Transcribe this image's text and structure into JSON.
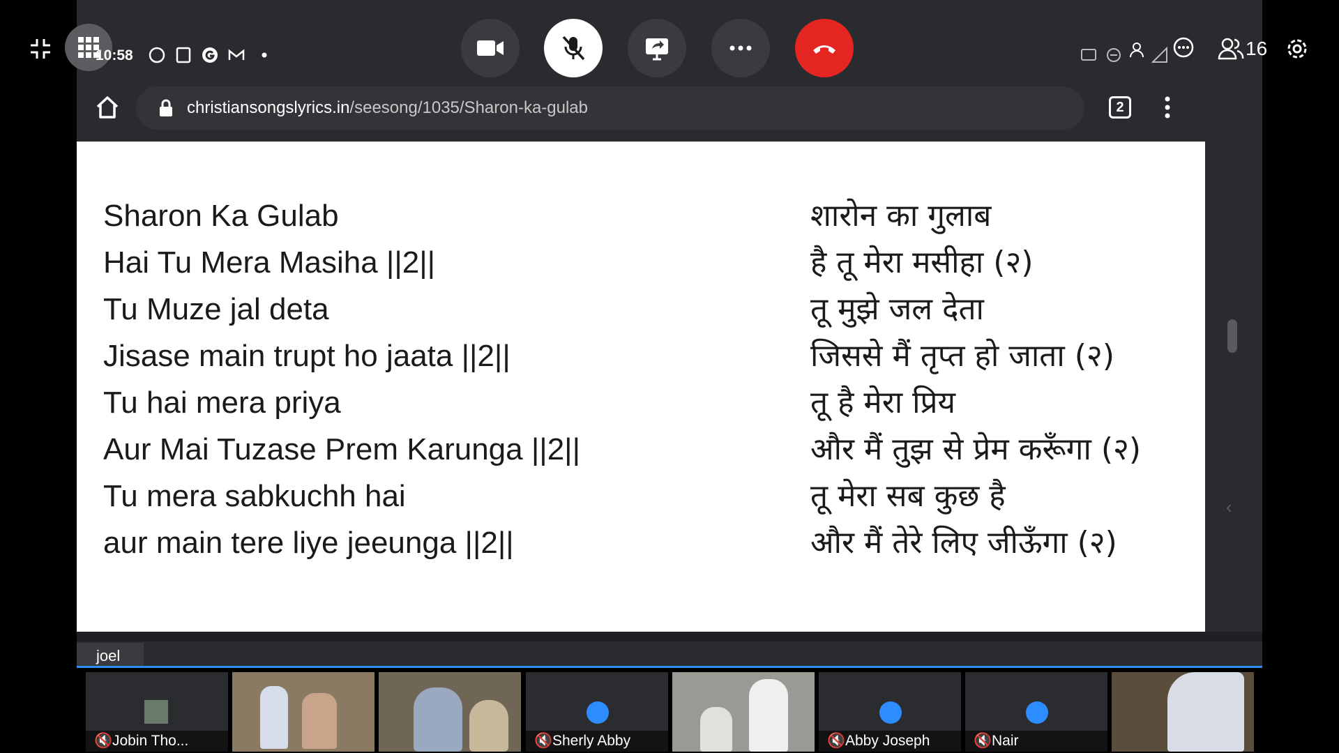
{
  "status_bar": {
    "clock": "10:58",
    "participants_count": "16"
  },
  "browser": {
    "url_host": "christiansongslyrics.in",
    "url_path": "/seesong/1035/Sharon-ka-gulab",
    "tab_count": "2"
  },
  "lyrics": {
    "english": [
      "Sharon Ka Gulab",
      "Hai Tu Mera Masiha ||2||",
      "Tu Muze jal deta",
      "Jisase main trupt ho jaata ||2||",
      "Tu hai mera priya",
      "Aur Mai Tuzase Prem Karunga ||2||",
      "Tu mera sabkuchh hai",
      "aur main tere liye jeeunga ||2||"
    ],
    "hindi": [
      "शारोन का गुलाब",
      "है तू मेरा मसीहा (२)",
      "तू मुझे जल देता",
      "जिससे मैं तृप्त हो जाता (२)",
      "तू है मेरा प्रिय",
      "और मैं तुझ से प्रेम करूँगा (२)",
      "तू मेरा सब कुछ है",
      "और मैं तेरे लिए जीऊँगा (२)"
    ]
  },
  "active_speaker": "joel",
  "participants": [
    {
      "name": "Jobin Tho...",
      "kind": "photo-avatar"
    },
    {
      "name": "",
      "kind": "video"
    },
    {
      "name": "",
      "kind": "video"
    },
    {
      "name": "Sherly Abby",
      "kind": "avatar"
    },
    {
      "name": "",
      "kind": "video"
    },
    {
      "name": "Abby Joseph",
      "kind": "avatar"
    },
    {
      "name": "Nair",
      "kind": "avatar"
    },
    {
      "name": "",
      "kind": "video"
    }
  ],
  "colors": {
    "end_call": "#e52521",
    "accent": "#2d8cff",
    "panel": "#2a2b2e"
  }
}
